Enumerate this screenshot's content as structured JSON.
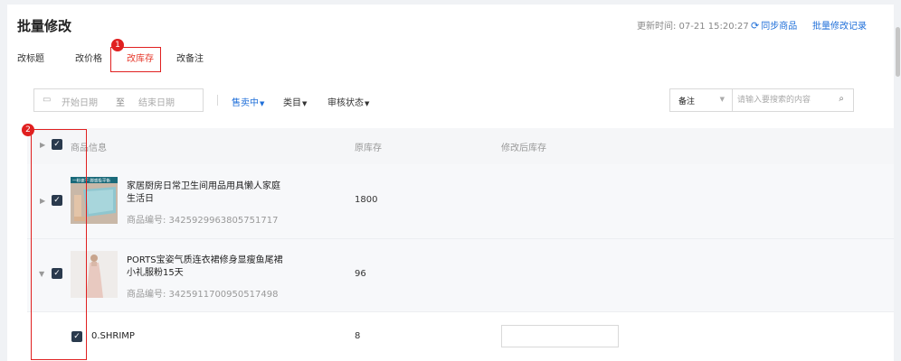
{
  "header": {
    "title": "批量修改",
    "update_time": "更新时间: 07-21 15:20:27",
    "sync_icon": "sync-icon",
    "sync_label": "同步商品",
    "history_label": "批量修改记录"
  },
  "tabs": [
    {
      "label": "改标题",
      "active": false
    },
    {
      "label": "改价格",
      "active": false
    },
    {
      "label": "改库存",
      "active": true
    },
    {
      "label": "改备注",
      "active": false
    }
  ],
  "markers": [
    "1",
    "2"
  ],
  "filters": {
    "date_start_placeholder": "开始日期",
    "date_separator": "至",
    "date_end_placeholder": "结束日期",
    "status": "售卖中",
    "category": "类目",
    "review": "审核状态"
  },
  "search": {
    "field": "备注",
    "placeholder": "请输入要搜索的内容"
  },
  "table": {
    "columns": [
      "商品信息",
      "原库存",
      "修改后库存"
    ],
    "products": [
      {
        "title": "家居厨房日常卫生间用品用具懒人家庭生活日",
        "code": "商品编号: 3425929963805751717",
        "stock": "1800",
        "thumb_text": "一秒速干 脚感极平衡"
      },
      {
        "title": "PORTS宝姿气质连衣裙修身显瘦鱼尾裙小礼服粉15天",
        "code": "商品编号: 3425911700950517498",
        "stock": "96"
      }
    ],
    "sku": {
      "name": "0.SHRIMP",
      "stock": "8"
    }
  },
  "colors": {
    "accent": "#1f6fd9",
    "active_tab": "#e63b2e",
    "highlight": "#e02020"
  }
}
